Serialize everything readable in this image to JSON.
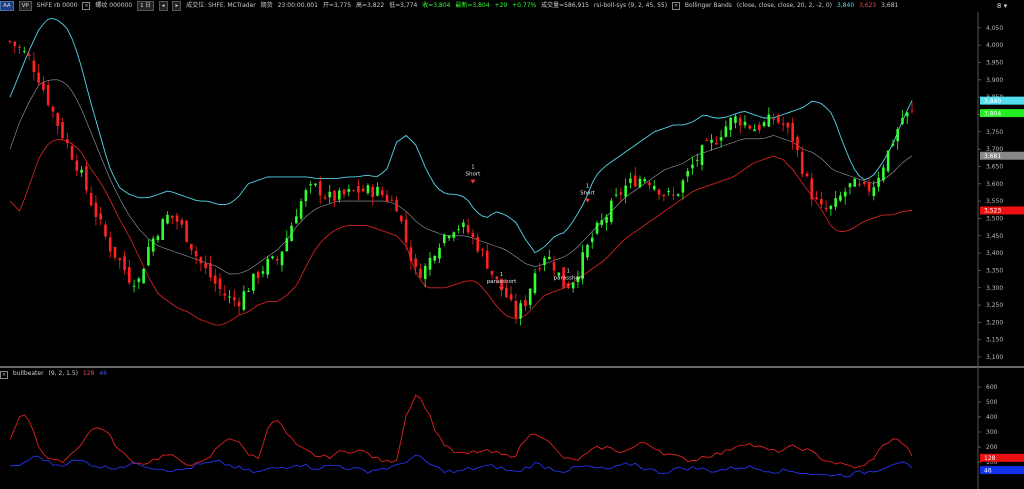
{
  "toolbar": {
    "tag_a": "AA",
    "tag_b": "VP",
    "symbol_code": "SHFE rb 0000",
    "symbol_name": "螺纹 000000",
    "period_button": "1 日",
    "arrow_left": "◂",
    "arrow_right": "▸",
    "trade_info": "成交位: SHFE. MCTrader",
    "period_label": "期货",
    "time": "23:00:00.001",
    "open": "开=3,775",
    "high": "高=3,822",
    "low": "低=3,774",
    "close": "收=3,804",
    "latest": "最新=3,804",
    "change": "+29",
    "change_pct": "+0.77%",
    "volume": "成交量=586,915",
    "strategy": "rsi-boll-sys (9, 2, 45, 55)",
    "indicator_name": "Bollinger Bands",
    "indicator_params": "(close, close, close, 20, 2, -2, 0)",
    "bb_upper_value": "3,840",
    "bb_lower_value": "3,623",
    "bb_mid_value": "3,681"
  },
  "corner": {
    "label": "8 ▾"
  },
  "sub_legend": {
    "name": "bullbeater",
    "params": "(9, 2, 1.5)",
    "value_red": "128",
    "value_blue": "46"
  },
  "colors": {
    "up": "#33ff33",
    "down": "#ff2222",
    "bb_upper": "#55d6e8",
    "bb_lower": "#cc2222",
    "bb_mid": "#9aa0a6",
    "osc_red": "#e02020",
    "osc_blue": "#2233ee",
    "background": "#000000"
  },
  "chart_data": {
    "type": "candlestick",
    "price_axis": {
      "ticks": [
        "4,050",
        "4,000",
        "3,950",
        "3,900",
        "3,850",
        "3,800",
        "3,750",
        "3,700",
        "3,650",
        "3,600",
        "3,550",
        "3,500",
        "3,450",
        "3,400",
        "3,350",
        "3,300",
        "3,250",
        "3,200",
        "3,150",
        "3,100"
      ],
      "ylim": [
        3080,
        4090
      ]
    },
    "price_tags": [
      {
        "label": "3,840",
        "value": 3840,
        "color": "#55e0f0"
      },
      {
        "label": "3,804",
        "value": 3804,
        "color": "#22ee22"
      },
      {
        "label": "3,681",
        "value": 3681,
        "color": "#888888"
      },
      {
        "label": "3,523",
        "value": 3523,
        "color": "#ee1111"
      }
    ],
    "close_anchors": [
      4010,
      3990,
      3960,
      3900,
      3830,
      3760,
      3700,
      3640,
      3560,
      3490,
      3420,
      3380,
      3330,
      3320,
      3420,
      3470,
      3510,
      3490,
      3440,
      3380,
      3340,
      3300,
      3270,
      3260,
      3300,
      3340,
      3370,
      3380,
      3450,
      3530,
      3580,
      3590,
      3560,
      3560,
      3570,
      3580,
      3580,
      3580,
      3560,
      3540,
      3430,
      3340,
      3360,
      3420,
      3460,
      3480,
      3470,
      3430,
      3380,
      3320,
      3280,
      3220,
      3260,
      3350,
      3400,
      3360,
      3300,
      3330,
      3400,
      3460,
      3500,
      3550,
      3590,
      3610,
      3620,
      3600,
      3570,
      3560,
      3610,
      3660,
      3700,
      3720,
      3760,
      3790,
      3780,
      3760,
      3770,
      3790,
      3770,
      3730,
      3640,
      3560,
      3520,
      3530,
      3570,
      3600,
      3580,
      3590,
      3650,
      3720,
      3790,
      3804
    ],
    "bb_upper_anchors": [
      3850,
      3920,
      3990,
      4050,
      4080,
      4070,
      4040,
      3960,
      3850,
      3750,
      3650,
      3590,
      3570,
      3560,
      3560,
      3570,
      3580,
      3570,
      3560,
      3550,
      3550,
      3540,
      3540,
      3560,
      3600,
      3610,
      3620,
      3620,
      3620,
      3620,
      3620,
      3615,
      3615,
      3615,
      3620,
      3620,
      3625,
      3620,
      3640,
      3720,
      3740,
      3710,
      3640,
      3590,
      3570,
      3570,
      3560,
      3520,
      3500,
      3520,
      3510,
      3490,
      3440,
      3400,
      3420,
      3450,
      3460,
      3500,
      3550,
      3620,
      3650,
      3670,
      3690,
      3710,
      3730,
      3750,
      3760,
      3770,
      3770,
      3780,
      3800,
      3790,
      3790,
      3800,
      3810,
      3800,
      3790,
      3790,
      3800,
      3810,
      3820,
      3840,
      3830,
      3800,
      3720,
      3650,
      3610,
      3620,
      3660,
      3710,
      3780,
      3840
    ],
    "bb_mid_anchors": [
      3700,
      3780,
      3840,
      3890,
      3900,
      3900,
      3880,
      3830,
      3760,
      3690,
      3620,
      3560,
      3510,
      3470,
      3440,
      3420,
      3410,
      3400,
      3390,
      3380,
      3370,
      3360,
      3340,
      3340,
      3350,
      3370,
      3390,
      3410,
      3440,
      3480,
      3510,
      3530,
      3540,
      3550,
      3550,
      3550,
      3550,
      3550,
      3550,
      3540,
      3520,
      3490,
      3470,
      3460,
      3450,
      3450,
      3450,
      3440,
      3430,
      3420,
      3410,
      3390,
      3370,
      3360,
      3370,
      3380,
      3390,
      3410,
      3440,
      3470,
      3500,
      3530,
      3560,
      3580,
      3600,
      3620,
      3640,
      3650,
      3660,
      3680,
      3690,
      3700,
      3710,
      3720,
      3730,
      3730,
      3730,
      3740,
      3730,
      3720,
      3700,
      3690,
      3670,
      3640,
      3630,
      3620,
      3610,
      3600,
      3610,
      3630,
      3660,
      3681
    ],
    "bb_lower_anchors": [
      3550,
      3520,
      3600,
      3680,
      3720,
      3730,
      3720,
      3700,
      3650,
      3610,
      3560,
      3500,
      3450,
      3390,
      3330,
      3280,
      3260,
      3240,
      3230,
      3210,
      3200,
      3190,
      3200,
      3220,
      3230,
      3250,
      3260,
      3260,
      3280,
      3310,
      3370,
      3420,
      3450,
      3470,
      3480,
      3480,
      3480,
      3470,
      3460,
      3450,
      3420,
      3340,
      3300,
      3300,
      3300,
      3310,
      3320,
      3320,
      3290,
      3250,
      3220,
      3210,
      3220,
      3250,
      3280,
      3290,
      3300,
      3320,
      3340,
      3360,
      3380,
      3410,
      3440,
      3460,
      3480,
      3500,
      3520,
      3540,
      3560,
      3580,
      3590,
      3600,
      3610,
      3620,
      3640,
      3660,
      3670,
      3680,
      3670,
      3640,
      3600,
      3560,
      3520,
      3470,
      3460,
      3470,
      3490,
      3500,
      3510,
      3510,
      3520,
      3523
    ],
    "signals": [
      {
        "label": "Short",
        "count": "1",
        "bar": 47,
        "price": 3615
      },
      {
        "label": "Short",
        "count": "1",
        "bar": 59,
        "price": 3560
      },
      {
        "label": "parasshort",
        "count": "1",
        "bar": 50,
        "price": 3305
      },
      {
        "label": "parasshort",
        "count": "1",
        "bar": 57,
        "price": 3315
      }
    ],
    "oscillator": {
      "name": "bullbeater",
      "ticks": [
        "600",
        "500",
        "400",
        "300",
        "200",
        "100"
      ],
      "ylim": [
        -60,
        660
      ],
      "red_anchors": [
        250,
        420,
        380,
        190,
        110,
        100,
        140,
        210,
        300,
        340,
        280,
        180,
        120,
        90,
        100,
        130,
        150,
        110,
        90,
        80,
        120,
        200,
        270,
        230,
        160,
        120,
        330,
        380,
        280,
        200,
        170,
        140,
        130,
        160,
        170,
        180,
        160,
        120,
        100,
        120,
        420,
        560,
        460,
        300,
        200,
        160,
        150,
        170,
        170,
        160,
        140,
        150,
        250,
        300,
        260,
        180,
        120,
        110,
        140,
        190,
        200,
        180,
        170,
        200,
        230,
        200,
        160,
        140,
        120,
        110,
        140,
        150,
        160,
        200,
        230,
        210,
        190,
        170,
        180,
        200,
        190,
        160,
        120,
        100,
        80,
        70,
        60,
        120,
        200,
        260,
        230,
        150
      ],
      "blue_anchors": [
        60,
        80,
        120,
        140,
        90,
        80,
        100,
        110,
        90,
        70,
        60,
        70,
        80,
        90,
        70,
        60,
        50,
        40,
        60,
        80,
        90,
        100,
        80,
        60,
        40,
        30,
        50,
        60,
        70,
        90,
        70,
        60,
        70,
        80,
        60,
        50,
        40,
        50,
        60,
        70,
        110,
        140,
        100,
        60,
        40,
        30,
        50,
        60,
        70,
        70,
        50,
        30,
        60,
        90,
        70,
        50,
        40,
        60,
        70,
        60,
        50,
        60,
        80,
        90,
        60,
        40,
        30,
        50,
        60,
        60,
        50,
        40,
        50,
        60,
        70,
        60,
        50,
        40,
        40,
        40,
        30,
        20,
        10,
        20,
        10,
        20,
        30,
        40,
        60,
        90,
        110,
        46
      ]
    },
    "osc_tags": [
      {
        "label": "128",
        "value": 128,
        "color": "#ee1111"
      },
      {
        "label": "46",
        "value": 46,
        "color": "#1133ee"
      }
    ]
  }
}
